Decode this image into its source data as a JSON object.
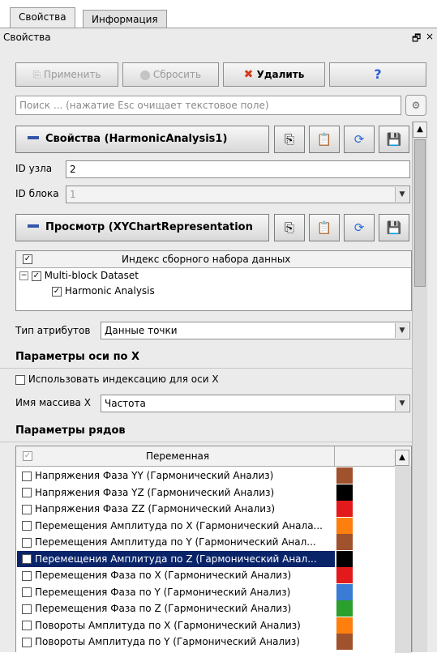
{
  "tabs": [
    "Свойства",
    "Информация"
  ],
  "panel_title": "Свойства",
  "window_icons": {
    "float": "🗗",
    "close": "×"
  },
  "toolbar": {
    "apply": "Применить",
    "reset": "Сбросить",
    "delete": "Удалить",
    "help": "?"
  },
  "search": {
    "placeholder": "Поиск ... (нажатие Esc очищает текстовое поле)"
  },
  "properties_section": {
    "title": "Свойства (HarmonicAnalysis1)"
  },
  "node_id": {
    "label": "ID узла",
    "value": "2"
  },
  "block_id": {
    "label": "ID блока",
    "value": "1"
  },
  "view_section": {
    "title": "Просмотр (XYChartRepresentation"
  },
  "composite_index": {
    "header": "Индекс сборного набора данных",
    "tree": [
      "Multi-block Dataset",
      "Harmonic Analysis"
    ]
  },
  "attribute_type": {
    "label": "Тип атрибутов",
    "value": "Данные точки"
  },
  "x_axis": {
    "title": "Параметры оси по X",
    "use_index_label": "Использовать индексацию для оси X",
    "array_label": "Имя массива X",
    "array_value": "Частота"
  },
  "series": {
    "title": "Параметры рядов",
    "column_header": "Переменная",
    "rows": [
      {
        "label": "Напряжения Фаза YY (Гармонический Анализ)",
        "checked": false,
        "color": "#a0522d"
      },
      {
        "label": "Напряжения Фаза YZ (Гармонический Анализ)",
        "checked": false,
        "color": "#000000"
      },
      {
        "label": "Напряжения Фаза ZZ (Гармонический Анализ)",
        "checked": false,
        "color": "#e31a1c"
      },
      {
        "label": "Перемещения Амплитуда по X (Гармонический Анала...",
        "checked": false,
        "color": "#ff7f0e"
      },
      {
        "label": "Перемещения Амплитуда по Y (Гармонический Анал...",
        "checked": false,
        "color": "#a0522d"
      },
      {
        "label": "Перемещения Амплитуда по Z (Гармонический Анал...",
        "checked": true,
        "color": "#000000"
      },
      {
        "label": "Перемещения Фаза по X (Гармонический Анализ)",
        "checked": false,
        "color": "#e31a1c"
      },
      {
        "label": "Перемещения Фаза по Y (Гармонический Анализ)",
        "checked": false,
        "color": "#3a7bd5"
      },
      {
        "label": "Перемещения Фаза по Z (Гармонический Анализ)",
        "checked": false,
        "color": "#2ca02c"
      },
      {
        "label": "Повороты Амплитуда по X (Гармонический Анализ)",
        "checked": false,
        "color": "#ff7f0e"
      },
      {
        "label": "Повороты Амплитуда по Y (Гармонический Анализ)",
        "checked": false,
        "color": "#a0522d"
      }
    ]
  }
}
